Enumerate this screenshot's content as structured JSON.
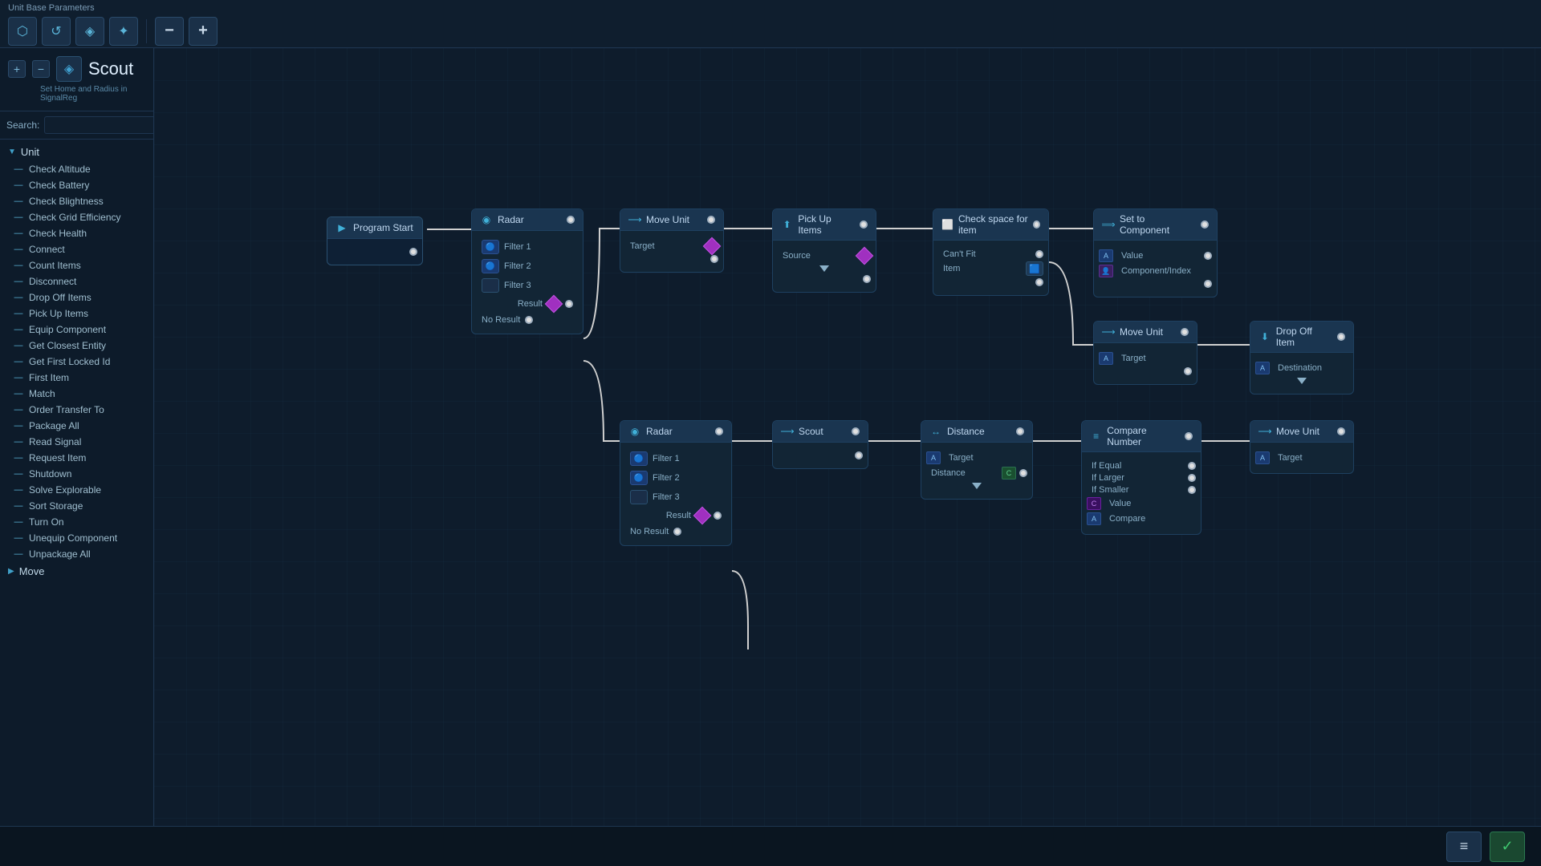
{
  "toolbar": {
    "title": "Unit Base Parameters",
    "buttons": [
      "⬡",
      "↺",
      "◈",
      "✦"
    ],
    "zoom_minus": "−",
    "zoom_plus": "+"
  },
  "unit": {
    "name": "Scout",
    "subtitle": "Set Home and Radius in SignalReg",
    "icon": "◈"
  },
  "search": {
    "label": "Search:",
    "placeholder": ""
  },
  "sidebar": {
    "group_unit": "Unit",
    "items": [
      "Check Altitude",
      "Check Battery",
      "Check Blightness",
      "Check Grid Efficiency",
      "Check Health",
      "Connect",
      "Count Items",
      "Disconnect",
      "Drop Off Items",
      "Pick Up Items",
      "Equip Component",
      "Get Closest Entity",
      "Get First Locked Id",
      "First Item",
      "Match",
      "Order Transfer To",
      "Package All",
      "Read Signal",
      "Request Item",
      "Shutdown",
      "Solve Explorable",
      "Sort Storage",
      "Turn On",
      "Unequip Component",
      "Unpackage All"
    ],
    "group_move": "Move"
  },
  "nodes": {
    "program_start": {
      "label": "Program Start"
    },
    "radar1": {
      "label": "Radar",
      "filters": [
        "Filter 1",
        "Filter 2",
        "Filter 3"
      ],
      "result": "Result",
      "noresult": "No Result"
    },
    "move_unit1": {
      "label": "Move Unit",
      "target": "Target"
    },
    "pickup": {
      "label": "Pick Up Items",
      "source": "Source"
    },
    "checkspace": {
      "label": "Check space for item",
      "cantfit": "Can't Fit",
      "item": "Item"
    },
    "setcomp": {
      "label": "Set to Component",
      "value": "Value",
      "compindex": "Component/Index"
    },
    "move_unit2": {
      "label": "Move Unit",
      "target": "Target"
    },
    "dropoff": {
      "label": "Drop Off Item",
      "dest": "Destination"
    },
    "radar2": {
      "label": "Radar",
      "filters": [
        "Filter 1",
        "Filter 2",
        "Filter 3"
      ],
      "result": "Result",
      "noresult": "No Result"
    },
    "scout": {
      "label": "Scout"
    },
    "distance": {
      "label": "Distance",
      "target": "Target",
      "distance": "Distance"
    },
    "compare": {
      "label": "Compare Number",
      "ifequal": "If Equal",
      "iflarger": "If Larger",
      "ifsmaller": "If Smaller",
      "value": "Value",
      "compare": "Compare"
    },
    "move_unit3": {
      "label": "Move Unit",
      "target": "Target"
    }
  },
  "bottom": {
    "list_icon": "≡",
    "check_icon": "✓"
  }
}
